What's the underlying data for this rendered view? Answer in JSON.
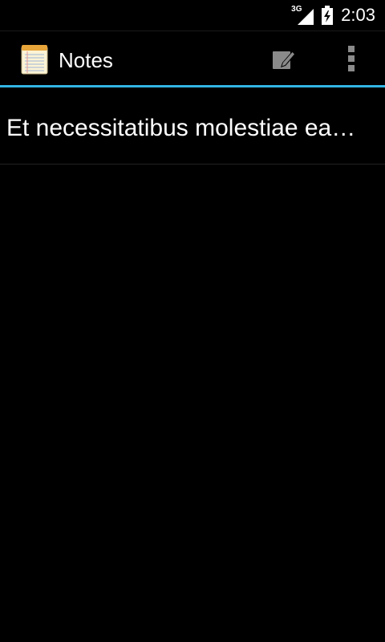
{
  "status_bar": {
    "network_type": "3G",
    "time": "2:03"
  },
  "action_bar": {
    "title": "Notes",
    "app_icon": "notepad-icon",
    "actions": [
      {
        "icon": "compose-icon"
      },
      {
        "icon": "overflow-menu-icon"
      }
    ]
  },
  "notes": [
    {
      "title": "Et necessitatibus molestiae ea…"
    }
  ],
  "colors": {
    "accent": "#33b5e5",
    "background": "#000000",
    "text": "#ffffff"
  }
}
